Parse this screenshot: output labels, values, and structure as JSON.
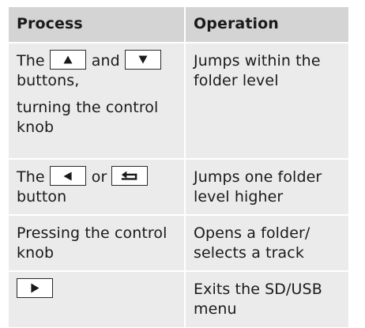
{
  "table": {
    "headers": [
      "Process",
      "Operation"
    ],
    "rows": [
      {
        "process_lines": [
          "The",
          "and",
          "buttons,",
          "turning the control",
          "knob"
        ],
        "operation": "Jumps within the folder level",
        "icons": [
          "up-arrow-icon",
          "down-arrow-icon"
        ]
      },
      {
        "process_lines": [
          "The",
          "or",
          "button"
        ],
        "operation": "Jumps one folder level higher",
        "icons": [
          "left-arrow-icon",
          "back-icon"
        ]
      },
      {
        "process": "Pressing the control knob",
        "operation": "Opens a folder/ selects a track"
      },
      {
        "process": "",
        "operation": "Exits the SD/USB menu",
        "icons": [
          "play-icon"
        ]
      }
    ]
  }
}
